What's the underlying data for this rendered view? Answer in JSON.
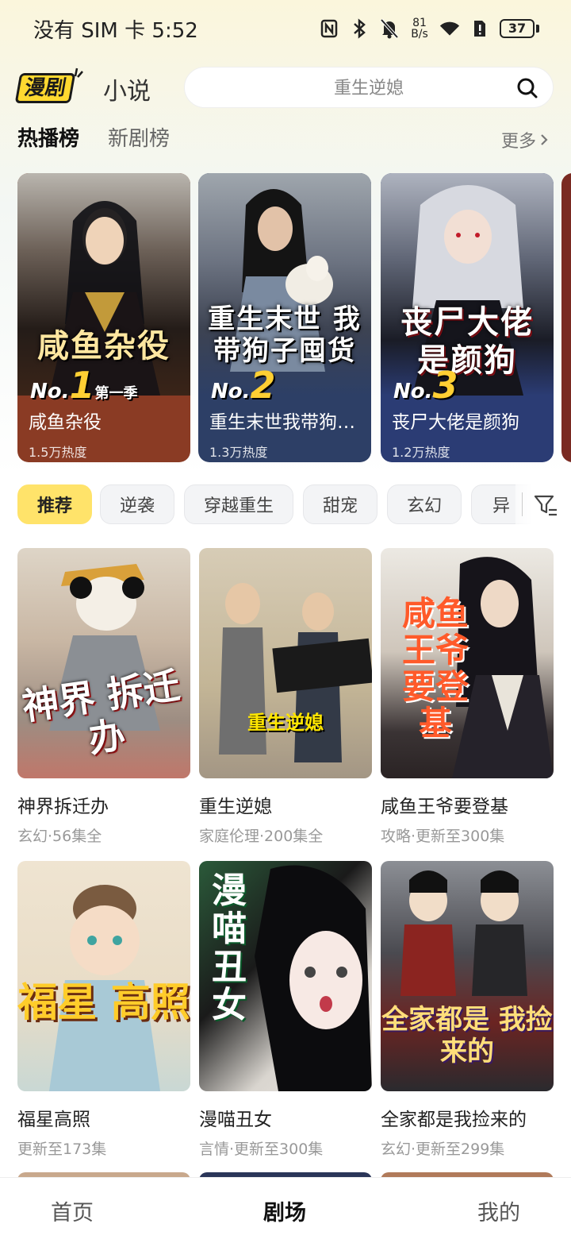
{
  "status_bar": {
    "carrier_time": "没有 SIM 卡 5:52",
    "net_speed_top": "81",
    "net_speed_bottom": "B/s",
    "battery": "37"
  },
  "header": {
    "logo_text": "漫剧",
    "novel_tab": "小说",
    "search_placeholder": "重生逆媳"
  },
  "rank_tabs": {
    "hot": "热播榜",
    "new": "新剧榜",
    "more": "更多"
  },
  "rank_cards": [
    {
      "overlay": "咸鱼杂役",
      "badge_prefix": "No.",
      "rank": "1",
      "badge_suffix": "第一季",
      "name": "咸鱼杂役",
      "heat": "1.5万热度",
      "color": "#8a3b24"
    },
    {
      "overlay": "重生末世 我带狗子囤货",
      "badge_prefix": "No.",
      "rank": "2",
      "badge_suffix": "",
      "name": "重生末世我带狗子…",
      "heat": "1.3万热度",
      "color": "#2d3f66"
    },
    {
      "overlay": "丧尸大佬 是颜狗",
      "badge_prefix": "No.",
      "rank": "3",
      "badge_suffix": "",
      "name": "丧尸大佬是颜狗",
      "heat": "1.2万热度",
      "color": "#2b3c74"
    }
  ],
  "chips": [
    "推荐",
    "逆袭",
    "穿越重生",
    "甜宠",
    "玄幻",
    "异"
  ],
  "grid": [
    {
      "overlay": "神界 拆迁办",
      "name": "神界拆迁办",
      "meta": "玄幻·56集全"
    },
    {
      "overlay": "重生逆媳",
      "name": "重生逆媳",
      "meta": "家庭伦理·200集全"
    },
    {
      "overlay": "咸鱼王爷要登基",
      "name": "咸鱼王爷要登基",
      "meta": "攻略·更新至300集"
    },
    {
      "overlay": "福星 高照",
      "name": "福星高照",
      "meta": "更新至173集"
    },
    {
      "overlay": "漫喵丑女",
      "name": "漫喵丑女",
      "meta": "言情·更新至300集"
    },
    {
      "overlay": "全家都是 我捡来的",
      "name": "全家都是我捡来的",
      "meta": "玄幻·更新至299集"
    }
  ],
  "bottom_nav": {
    "home": "首页",
    "theater": "剧场",
    "mine": "我的"
  }
}
